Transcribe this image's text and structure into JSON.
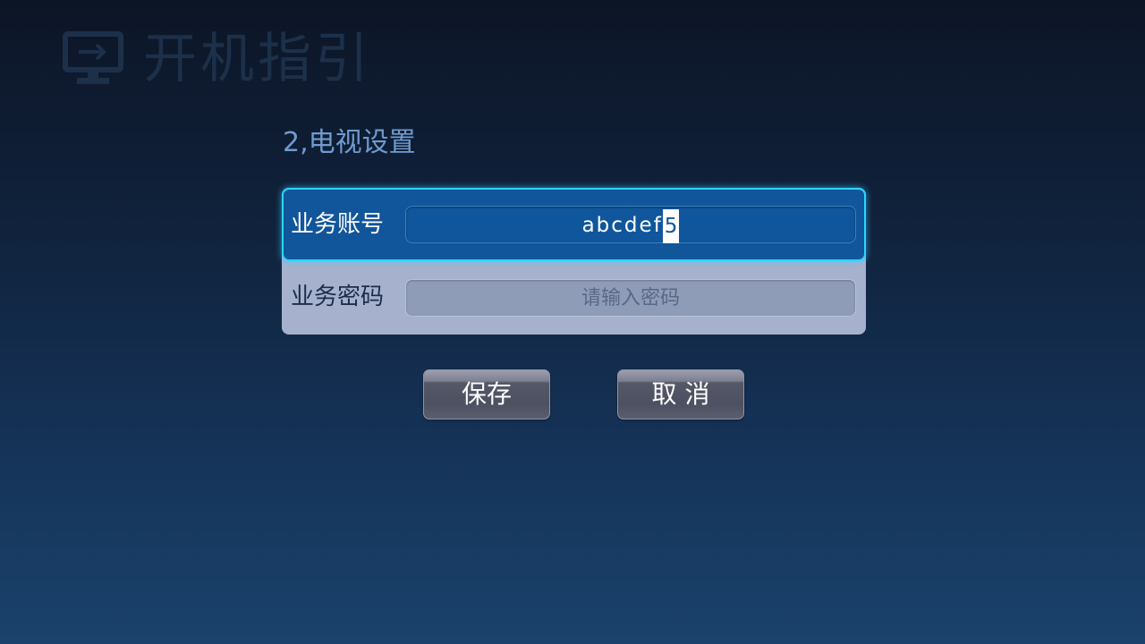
{
  "header": {
    "title": "开机指引",
    "icon": "monitor-arrow-icon"
  },
  "step": {
    "title": "2,电视设置"
  },
  "form": {
    "account": {
      "label": "业务账号",
      "value": "abcdef",
      "cursor_char": "5"
    },
    "password": {
      "label": "业务密码",
      "placeholder": "请输入密码"
    }
  },
  "buttons": {
    "save_label": "保存",
    "cancel_label": "取 消"
  },
  "colors": {
    "accent_focus": "#2ad6ff",
    "active_row": "#11559b",
    "header_text": "#1d3049",
    "step_text": "#6f9bcf"
  }
}
